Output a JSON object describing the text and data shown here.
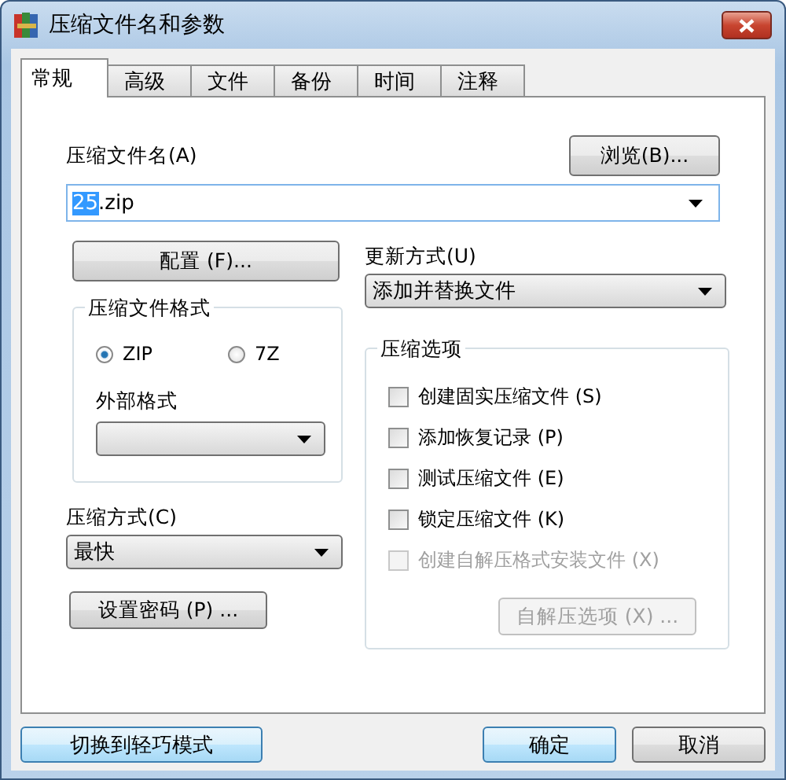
{
  "window": {
    "title": "压缩文件名和参数"
  },
  "tabs": [
    {
      "label": "常规",
      "selected": true
    },
    {
      "label": "高级",
      "selected": false
    },
    {
      "label": "文件",
      "selected": false
    },
    {
      "label": "备份",
      "selected": false
    },
    {
      "label": "时间",
      "selected": false
    },
    {
      "label": "注释",
      "selected": false
    }
  ],
  "archive_name": {
    "label": "压缩文件名(A)",
    "value_parts": [
      {
        "text": "25",
        "selected": true
      },
      {
        "text": ".zip",
        "selected": false
      }
    ]
  },
  "browse_button": "浏览(B)...",
  "profiles_button": "配置 (F)...",
  "update_mode": {
    "label": "更新方式(U)",
    "value": "添加并替换文件"
  },
  "archive_format": {
    "title": "压缩文件格式",
    "options": [
      {
        "label": "ZIP",
        "selected": true
      },
      {
        "label": "7Z",
        "selected": false
      }
    ],
    "external_format_label": "外部格式"
  },
  "compression_method": {
    "label": "压缩方式(C)",
    "value": "最快"
  },
  "password_button": "设置密码 (P) ...",
  "compression_options": {
    "title": "压缩选项",
    "items": [
      {
        "label": "创建固实压缩文件 (S)",
        "checked": false,
        "disabled": false
      },
      {
        "label": "添加恢复记录 (P)",
        "checked": false,
        "disabled": false
      },
      {
        "label": "测试压缩文件 (E)",
        "checked": false,
        "disabled": false
      },
      {
        "label": "锁定压缩文件 (K)",
        "checked": false,
        "disabled": false
      },
      {
        "label": "创建自解压格式安装文件 (X)",
        "checked": false,
        "disabled": true
      }
    ]
  },
  "sfx_options_button": {
    "label": "自解压选项 (X) ...",
    "disabled": true
  },
  "footer_buttons": [
    {
      "label": "切换到轻巧模式",
      "kind": "mode",
      "highlighted": true
    },
    {
      "label": "确定",
      "kind": "ok",
      "highlighted": true
    },
    {
      "label": "取消",
      "kind": "cancel",
      "highlighted": false
    }
  ]
}
